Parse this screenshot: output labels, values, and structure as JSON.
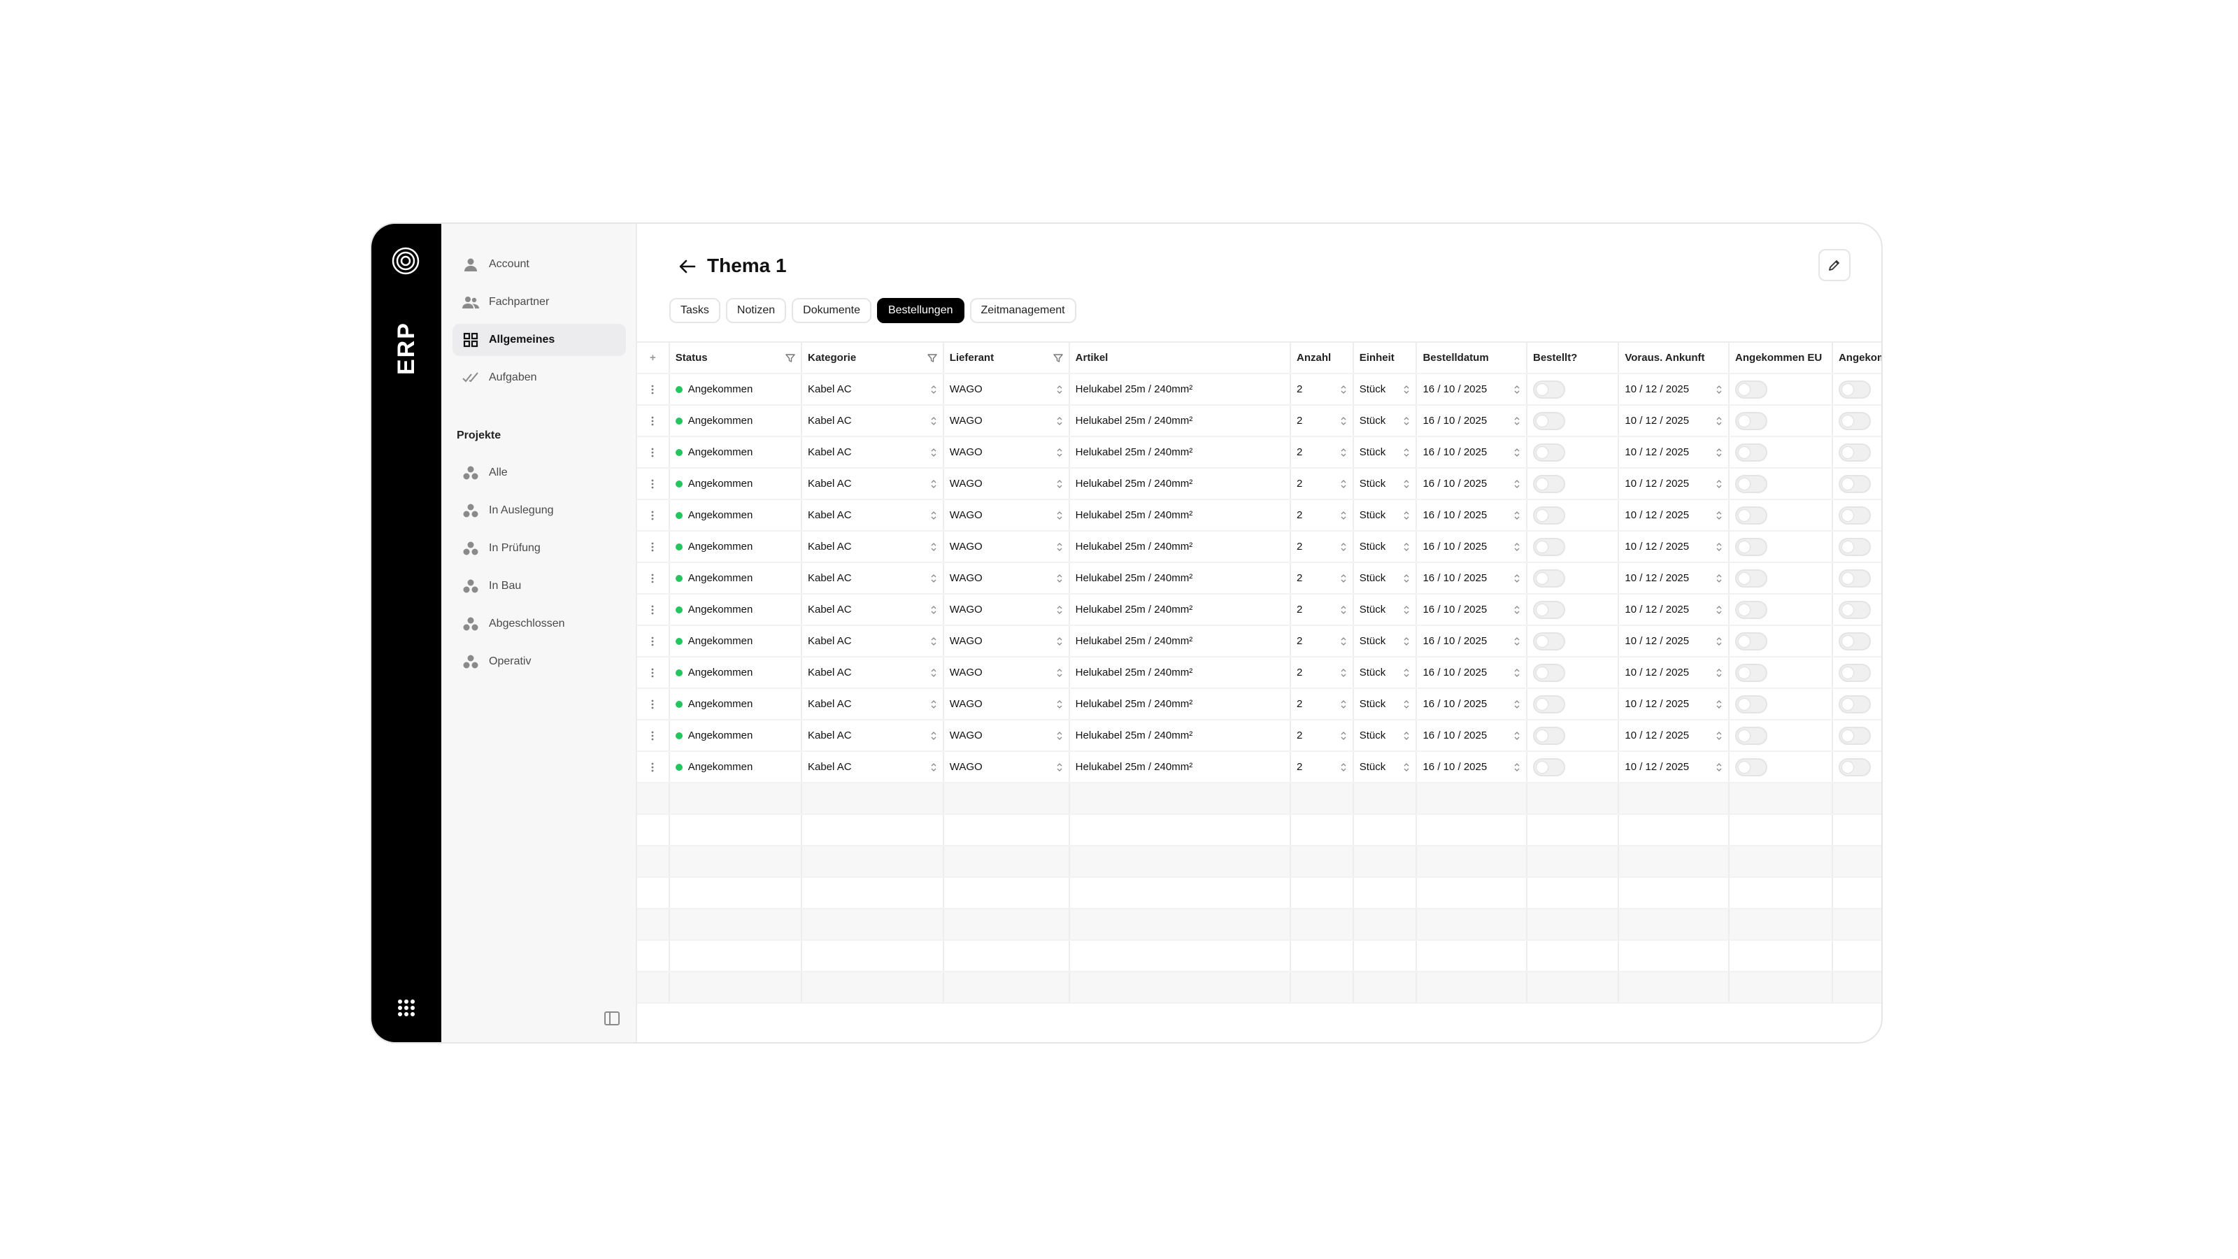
{
  "app": {
    "name": "ERP"
  },
  "sidebar": {
    "items": [
      {
        "label": "Account",
        "icon": "user-icon",
        "active": false
      },
      {
        "label": "Fachpartner",
        "icon": "users-icon",
        "active": false
      },
      {
        "label": "Allgemeines",
        "icon": "grid-icon",
        "active": true
      },
      {
        "label": "Aufgaben",
        "icon": "check-double-icon",
        "active": false
      }
    ],
    "section_label": "Projekte",
    "projects": [
      {
        "label": "Alle"
      },
      {
        "label": "In Auslegung"
      },
      {
        "label": "In Prüfung"
      },
      {
        "label": "In Bau"
      },
      {
        "label": "Abgeschlossen"
      },
      {
        "label": "Operativ"
      }
    ]
  },
  "header": {
    "title": "Thema 1"
  },
  "tabs": [
    {
      "label": "Tasks",
      "active": false
    },
    {
      "label": "Notizen",
      "active": false
    },
    {
      "label": "Dokumente",
      "active": false
    },
    {
      "label": "Bestellungen",
      "active": true
    },
    {
      "label": "Zeitmanagement",
      "active": false
    }
  ],
  "table": {
    "add_symbol": "+",
    "columns": [
      "Status",
      "Kategorie",
      "Lieferant",
      "Artikel",
      "Anzahl",
      "Einheit",
      "Bestelldatum",
      "Bestellt?",
      "Voraus. Ankunft",
      "Angekommen EU",
      "Angekom"
    ],
    "rows": [
      {
        "status": "Angekommen",
        "kategorie": "Kabel AC",
        "lieferant": "WAGO",
        "artikel": "Helukabel 25m / 240mm²",
        "anzahl": "2",
        "einheit": "Stück",
        "bestelldatum": "16 / 10 / 2025",
        "bestellt": false,
        "ankunft": "10 / 12 / 2025",
        "angekommen_eu": false,
        "angekommen": false
      },
      {
        "status": "Angekommen",
        "kategorie": "Kabel AC",
        "lieferant": "WAGO",
        "artikel": "Helukabel 25m / 240mm²",
        "anzahl": "2",
        "einheit": "Stück",
        "bestelldatum": "16 / 10 / 2025",
        "bestellt": false,
        "ankunft": "10 / 12 / 2025",
        "angekommen_eu": false,
        "angekommen": false
      },
      {
        "status": "Angekommen",
        "kategorie": "Kabel AC",
        "lieferant": "WAGO",
        "artikel": "Helukabel 25m / 240mm²",
        "anzahl": "2",
        "einheit": "Stück",
        "bestelldatum": "16 / 10 / 2025",
        "bestellt": false,
        "ankunft": "10 / 12 / 2025",
        "angekommen_eu": false,
        "angekommen": false
      },
      {
        "status": "Angekommen",
        "kategorie": "Kabel AC",
        "lieferant": "WAGO",
        "artikel": "Helukabel 25m / 240mm²",
        "anzahl": "2",
        "einheit": "Stück",
        "bestelldatum": "16 / 10 / 2025",
        "bestellt": false,
        "ankunft": "10 / 12 / 2025",
        "angekommen_eu": false,
        "angekommen": false
      },
      {
        "status": "Angekommen",
        "kategorie": "Kabel AC",
        "lieferant": "WAGO",
        "artikel": "Helukabel 25m / 240mm²",
        "anzahl": "2",
        "einheit": "Stück",
        "bestelldatum": "16 / 10 / 2025",
        "bestellt": false,
        "ankunft": "10 / 12 / 2025",
        "angekommen_eu": false,
        "angekommen": false
      },
      {
        "status": "Angekommen",
        "kategorie": "Kabel AC",
        "lieferant": "WAGO",
        "artikel": "Helukabel 25m / 240mm²",
        "anzahl": "2",
        "einheit": "Stück",
        "bestelldatum": "16 / 10 / 2025",
        "bestellt": false,
        "ankunft": "10 / 12 / 2025",
        "angekommen_eu": false,
        "angekommen": false
      },
      {
        "status": "Angekommen",
        "kategorie": "Kabel AC",
        "lieferant": "WAGO",
        "artikel": "Helukabel 25m / 240mm²",
        "anzahl": "2",
        "einheit": "Stück",
        "bestelldatum": "16 / 10 / 2025",
        "bestellt": false,
        "ankunft": "10 / 12 / 2025",
        "angekommen_eu": false,
        "angekommen": false
      },
      {
        "status": "Angekommen",
        "kategorie": "Kabel AC",
        "lieferant": "WAGO",
        "artikel": "Helukabel 25m / 240mm²",
        "anzahl": "2",
        "einheit": "Stück",
        "bestelldatum": "16 / 10 / 2025",
        "bestellt": false,
        "ankunft": "10 / 12 / 2025",
        "angekommen_eu": false,
        "angekommen": false
      },
      {
        "status": "Angekommen",
        "kategorie": "Kabel AC",
        "lieferant": "WAGO",
        "artikel": "Helukabel 25m / 240mm²",
        "anzahl": "2",
        "einheit": "Stück",
        "bestelldatum": "16 / 10 / 2025",
        "bestellt": false,
        "ankunft": "10 / 12 / 2025",
        "angekommen_eu": false,
        "angekommen": false
      },
      {
        "status": "Angekommen",
        "kategorie": "Kabel AC",
        "lieferant": "WAGO",
        "artikel": "Helukabel 25m / 240mm²",
        "anzahl": "2",
        "einheit": "Stück",
        "bestelldatum": "16 / 10 / 2025",
        "bestellt": false,
        "ankunft": "10 / 12 / 2025",
        "angekommen_eu": false,
        "angekommen": false
      },
      {
        "status": "Angekommen",
        "kategorie": "Kabel AC",
        "lieferant": "WAGO",
        "artikel": "Helukabel 25m / 240mm²",
        "anzahl": "2",
        "einheit": "Stück",
        "bestelldatum": "16 / 10 / 2025",
        "bestellt": false,
        "ankunft": "10 / 12 / 2025",
        "angekommen_eu": false,
        "angekommen": false
      },
      {
        "status": "Angekommen",
        "kategorie": "Kabel AC",
        "lieferant": "WAGO",
        "artikel": "Helukabel 25m / 240mm²",
        "anzahl": "2",
        "einheit": "Stück",
        "bestelldatum": "16 / 10 / 2025",
        "bestellt": false,
        "ankunft": "10 / 12 / 2025",
        "angekommen_eu": false,
        "angekommen": false
      },
      {
        "status": "Angekommen",
        "kategorie": "Kabel AC",
        "lieferant": "WAGO",
        "artikel": "Helukabel 25m / 240mm²",
        "anzahl": "2",
        "einheit": "Stück",
        "bestelldatum": "16 / 10 / 2025",
        "bestellt": false,
        "ankunft": "10 / 12 / 2025",
        "angekommen_eu": false,
        "angekommen": false
      }
    ]
  },
  "colors": {
    "rail": "#000000",
    "sidebar": "#f7f7f8",
    "status_green": "#22c55e",
    "active_tab": "#000000"
  }
}
